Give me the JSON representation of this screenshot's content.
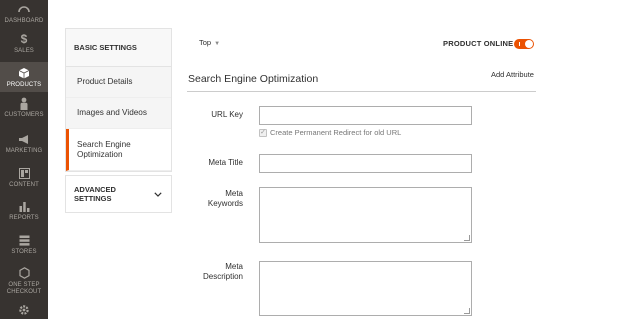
{
  "admin_nav": [
    {
      "label": "DASHBOARD",
      "icon": "dashboard-icon"
    },
    {
      "label": "SALES",
      "icon": "dollar-icon"
    },
    {
      "label": "PRODUCTS",
      "icon": "box-icon",
      "active": true
    },
    {
      "label": "CUSTOMERS",
      "icon": "person-icon"
    },
    {
      "label": "MARKETING",
      "icon": "megaphone-icon"
    },
    {
      "label": "CONTENT",
      "icon": "layout-icon"
    },
    {
      "label": "REPORTS",
      "icon": "bar-chart-icon"
    },
    {
      "label": "STORES",
      "icon": "store-icon"
    },
    {
      "label": "ONE STEP CHECKOUT",
      "icon": "hexagon-icon"
    },
    {
      "label": "",
      "icon": "gear-icon"
    }
  ],
  "settings": {
    "basic_label": "BASIC SETTINGS",
    "items": [
      {
        "label": "Product Details"
      },
      {
        "label": "Images and Videos"
      },
      {
        "label": "Search Engine Optimization",
        "active": true
      }
    ],
    "advanced_label": "ADVANCED SETTINGS"
  },
  "topbar": {
    "scope": "Top",
    "product_online_label": "PRODUCT ONLINE",
    "product_online": true,
    "add_attribute": "Add Attribute"
  },
  "section": {
    "title": "Search Engine Optimization"
  },
  "form": {
    "url_key": {
      "label": "URL Key",
      "value": ""
    },
    "redirect": {
      "label": "Create Permanent Redirect for old URL",
      "checked": true
    },
    "meta_title": {
      "label": "Meta Title",
      "value": ""
    },
    "meta_keywords": {
      "label": "Meta Keywords",
      "value": ""
    },
    "meta_description": {
      "label": "Meta Description",
      "value": ""
    }
  },
  "colors": {
    "nav_bg": "#373330",
    "nav_active": "#524d49",
    "accent": "#eb5202"
  }
}
